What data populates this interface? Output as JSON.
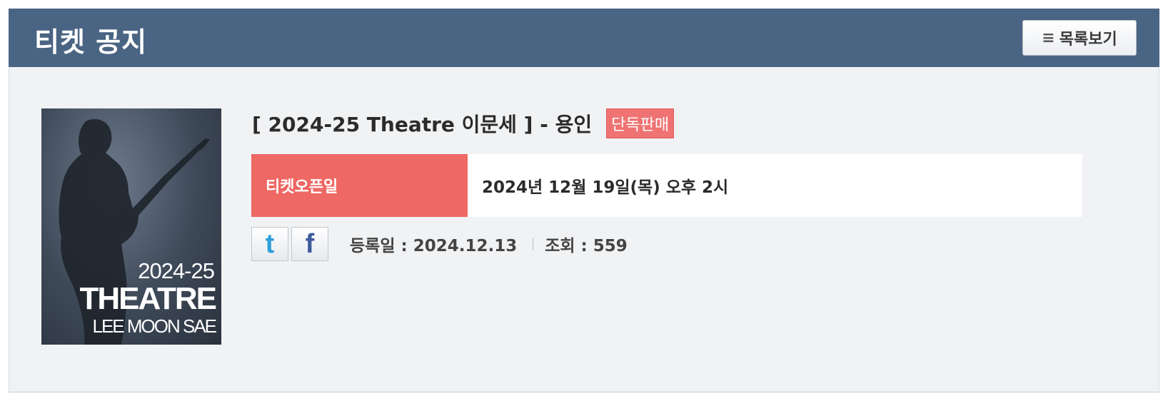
{
  "header": {
    "title": "티켓 공지",
    "list_button_label": "목록보기",
    "list_icon": "menu-icon"
  },
  "poster": {
    "year": "2024-25",
    "title": "THEATRE",
    "artist": "LEE MOON SAE"
  },
  "notice": {
    "title": "[ 2024-25 Theatre 이문세 ] - 용인",
    "badge": "단독판매",
    "open_label": "티켓오픈일",
    "open_value": "2024년 12월 19일(목) 오후 2시"
  },
  "meta": {
    "twitter_icon": "t",
    "facebook_icon": "f",
    "registered": "등록일 : 2024.12.13",
    "views": "조회 : 559"
  },
  "colors": {
    "header_bg": "#4a6483",
    "open_label_bg": "#ee6864",
    "badge_bg": "#ef7373"
  }
}
